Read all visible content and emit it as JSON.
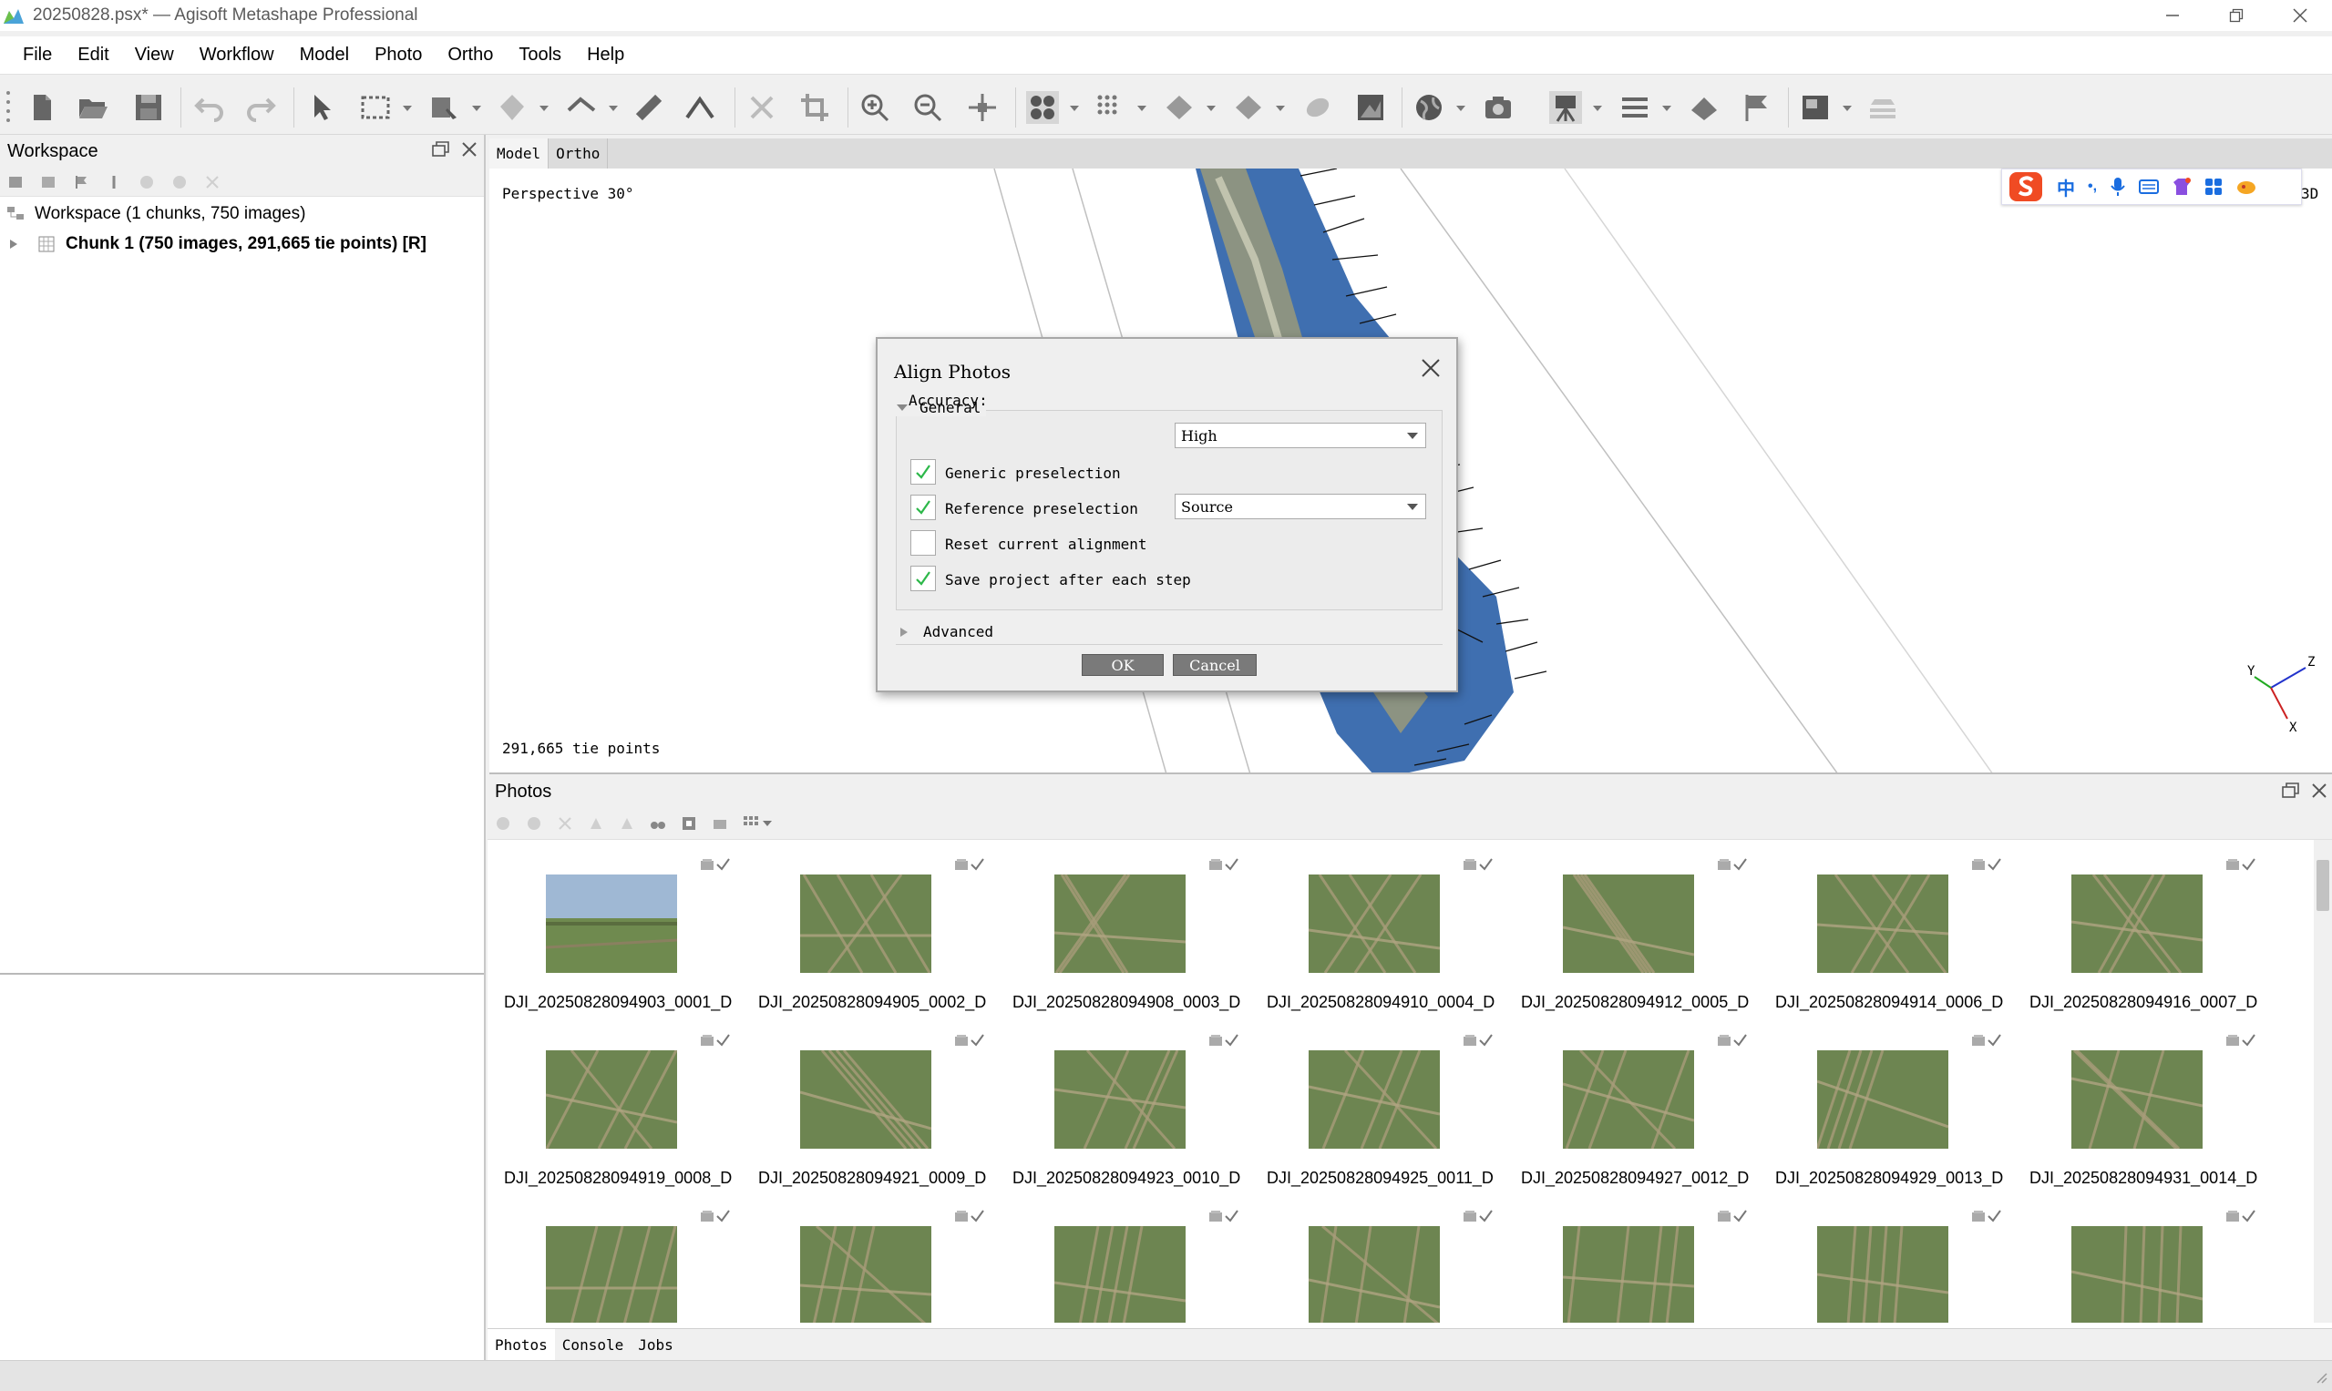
{
  "window": {
    "title": "20250828.psx* — Agisoft Metashape Professional",
    "controls": [
      "minimize",
      "restore",
      "close"
    ]
  },
  "menu": [
    "File",
    "Edit",
    "View",
    "Workflow",
    "Model",
    "Photo",
    "Ortho",
    "Tools",
    "Help"
  ],
  "workspace": {
    "title": "Workspace",
    "root_label": "Workspace (1 chunks, 750 images)",
    "chunk_label": "Chunk 1 (750 images, 291,665 tie points) [R]"
  },
  "view_tabs": [
    "Model",
    "Ortho"
  ],
  "model_view": {
    "projection": "Perspective 30°",
    "corner_label": "3D",
    "tie_points": "291,665 tie points",
    "axes": {
      "x": "X",
      "y": "Y",
      "z": "Z"
    }
  },
  "ime": {
    "lang": "中",
    "punct": "•,"
  },
  "dialog": {
    "title": "Align Photos",
    "general_label": "General",
    "accuracy_label": "Accuracy:",
    "accuracy_value": "High",
    "generic_preselection": {
      "label": "Generic preselection",
      "checked": true
    },
    "reference_preselection": {
      "label": "Reference preselection",
      "checked": true,
      "mode": "Source"
    },
    "reset_alignment": {
      "label": "Reset current alignment",
      "checked": false
    },
    "save_project": {
      "label": "Save project after each step",
      "checked": true
    },
    "advanced_label": "Advanced",
    "ok_label": "OK",
    "cancel_label": "Cancel"
  },
  "photos": {
    "title": "Photos",
    "items": [
      "DJI_20250828094903_0001_D",
      "DJI_20250828094905_0002_D",
      "DJI_20250828094908_0003_D",
      "DJI_20250828094910_0004_D",
      "DJI_20250828094912_0005_D",
      "DJI_20250828094914_0006_D",
      "DJI_20250828094916_0007_D",
      "DJI_20250828094919_0008_D",
      "DJI_20250828094921_0009_D",
      "DJI_20250828094923_0010_D",
      "DJI_20250828094925_0011_D",
      "DJI_20250828094927_0012_D",
      "DJI_20250828094929_0013_D",
      "DJI_20250828094931_0014_D",
      "",
      "",
      "",
      "",
      "",
      "",
      ""
    ]
  },
  "bottom_tabs": [
    "Photos",
    "Console",
    "Jobs"
  ],
  "colors": {
    "tie_point_blue": "#3f6fb0",
    "check_green": "#2db84a"
  }
}
